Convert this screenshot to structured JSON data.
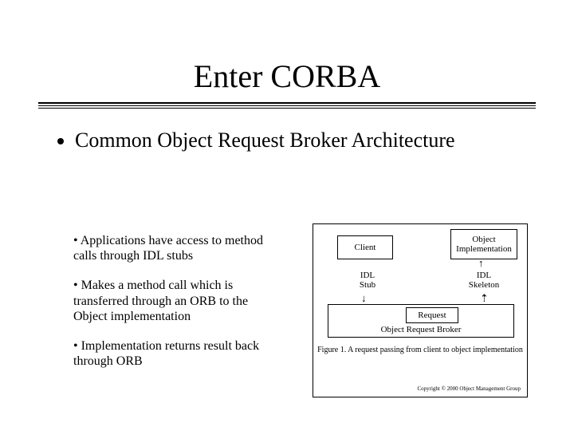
{
  "title": "Enter CORBA",
  "main_bullet": "Common Object Request Broker Architecture",
  "left": {
    "p1": "• Applications have access to method calls through IDL stubs",
    "p2": "• Makes a method call which is transferred through an ORB to the Object implementation",
    "p3": "• Implementation returns result back through ORB"
  },
  "diagram": {
    "client": "Client",
    "object_impl": "Object Implementation",
    "idl_stub": "IDL Stub",
    "idl_skeleton": "IDL Skeleton",
    "request": "Request",
    "orb": "Object Request Broker",
    "caption": "Figure 1. A request passing from client to object implementation",
    "copyright": "Copyright © 2000 Object Management Group"
  }
}
